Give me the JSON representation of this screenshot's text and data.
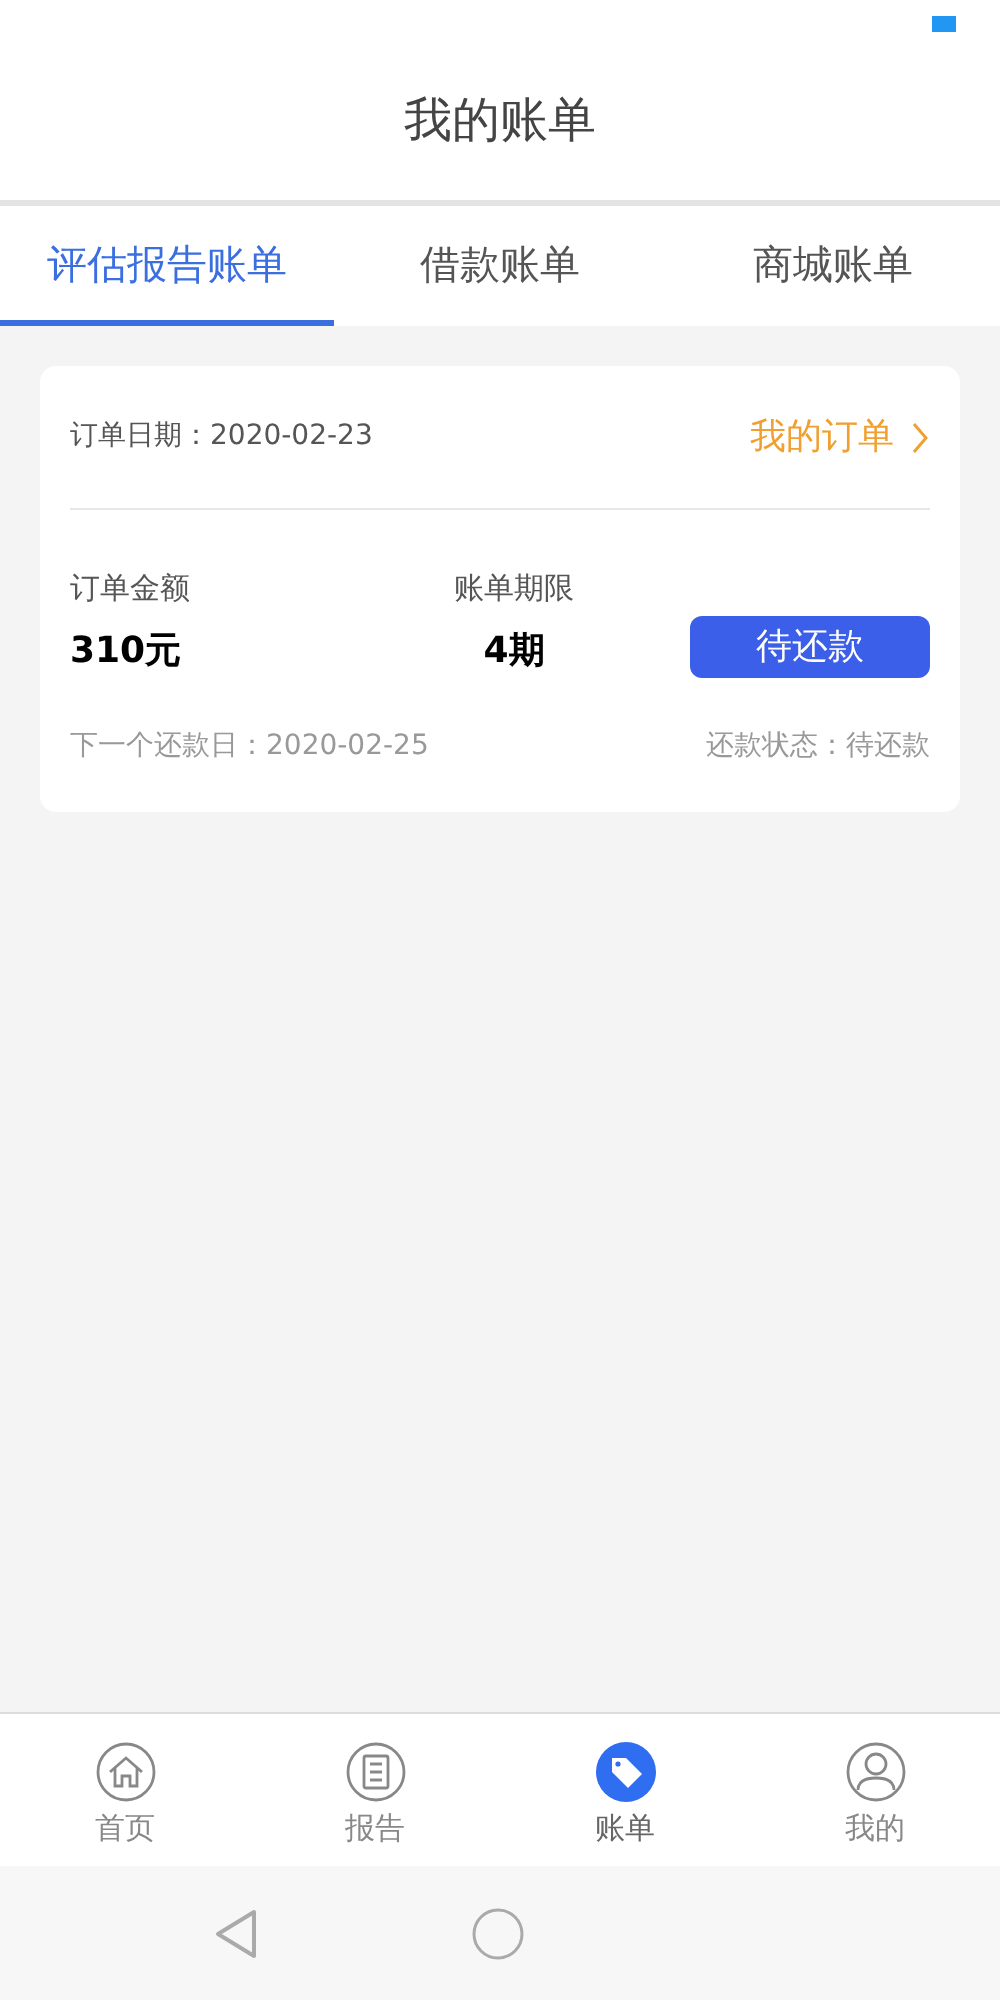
{
  "header": {
    "title": "我的账单"
  },
  "tabs": [
    {
      "label": "评估报告账单",
      "selected": true
    },
    {
      "label": "借款账单",
      "selected": false
    },
    {
      "label": "商城账单",
      "selected": false
    }
  ],
  "bills": [
    {
      "order_date": "订单日期：2020-02-23",
      "order_link": "我的订单",
      "amount_label": "订单金额",
      "amount": "310元",
      "term_label": "账单期限",
      "term": "4期",
      "action": "待还款",
      "next_due": "下一个还款日：2020-02-25",
      "repay_status": "还款状态：待还款"
    }
  ],
  "bottom_nav": [
    {
      "label": "首页",
      "kind": "home",
      "selected": false
    },
    {
      "label": "报告",
      "kind": "report",
      "selected": false
    },
    {
      "label": "账单",
      "kind": "tag",
      "selected": true
    },
    {
      "label": "我的",
      "kind": "user",
      "selected": false
    }
  ]
}
